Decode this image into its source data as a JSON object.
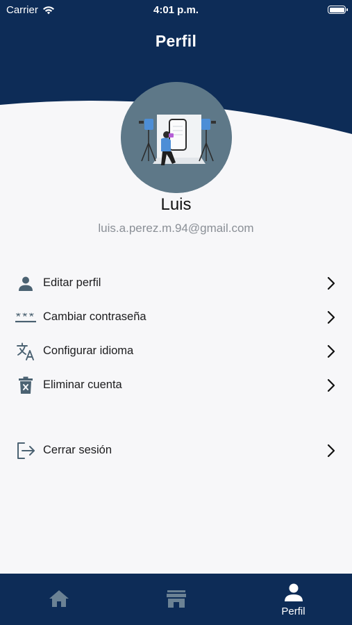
{
  "status_bar": {
    "carrier": "Carrier",
    "time": "4:01 p.m."
  },
  "header": {
    "title": "Perfil",
    "color": "#0d2c57"
  },
  "profile": {
    "name": "Luis",
    "email": "luis.a.perez.m.94@gmail.com"
  },
  "menu": {
    "items": [
      {
        "label": "Editar perfil",
        "icon": "person-icon"
      },
      {
        "label": "Cambiar contraseña",
        "icon": "password-icon"
      },
      {
        "label": "Configurar idioma",
        "icon": "translate-icon"
      },
      {
        "label": "Eliminar cuenta",
        "icon": "trash-icon"
      },
      {
        "label": "Cerrar sesión",
        "icon": "logout-icon"
      }
    ]
  },
  "tabbar": {
    "tabs": [
      {
        "label": "",
        "icon": "home-icon",
        "active": false
      },
      {
        "label": "",
        "icon": "store-icon",
        "active": false
      },
      {
        "label": "Perfil",
        "icon": "person-icon",
        "active": true
      }
    ]
  }
}
